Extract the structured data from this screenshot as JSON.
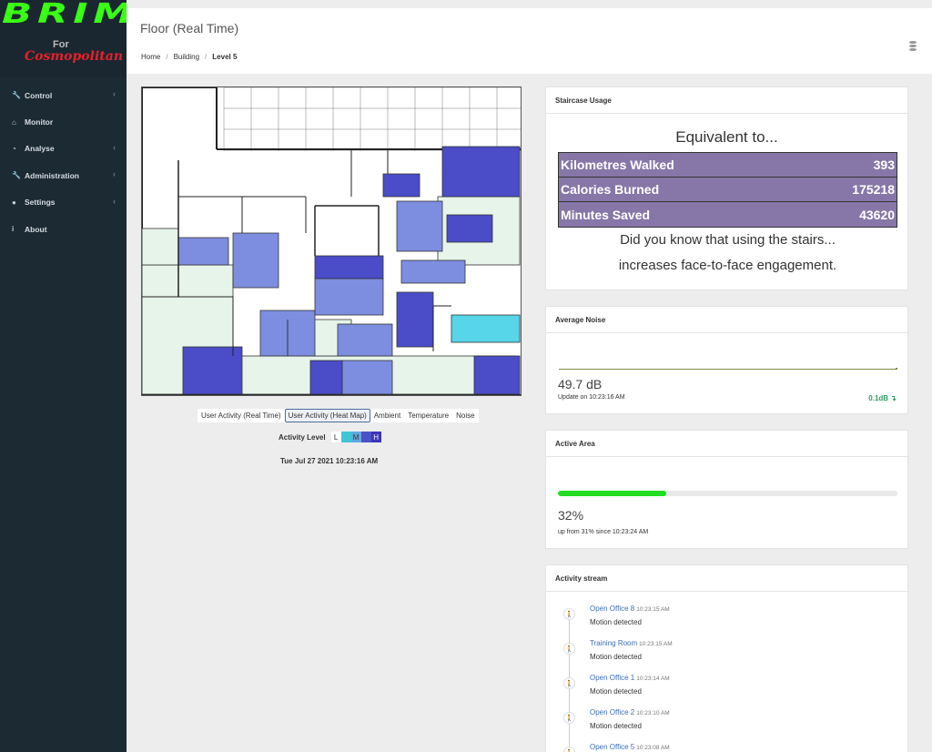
{
  "sidebar": {
    "brand": "BRIM",
    "for_label": "For",
    "client": "Cosmopolitan",
    "items": [
      {
        "label": "Control",
        "icon": "wrench-icon",
        "glyph": "🔧",
        "chevron": true
      },
      {
        "label": "Monitor",
        "icon": "home-icon",
        "glyph": "⌂",
        "chevron": false
      },
      {
        "label": "Analyse",
        "icon": "dashboard-icon",
        "glyph": "◔",
        "chevron": true
      },
      {
        "label": "Administration",
        "icon": "wrench-icon",
        "glyph": "🔧",
        "chevron": true
      },
      {
        "label": "Settings",
        "icon": "user-icon",
        "glyph": "●",
        "chevron": true
      },
      {
        "label": "About",
        "icon": "info-icon",
        "glyph": "i",
        "chevron": false
      }
    ]
  },
  "header": {
    "title": "Floor (Real Time)",
    "breadcrumb": [
      "Home",
      "Building",
      "Level 5"
    ]
  },
  "map": {
    "tabs": [
      "User Activity (Real Time)",
      "User Activity (Heat Map)",
      "Ambient",
      "Temperature",
      "Noise"
    ],
    "active_tab": 1,
    "activity_label": "Activity Level",
    "levels": [
      {
        "label": "L",
        "color": "#ffffff"
      },
      {
        "label": "",
        "color": "#3ec6d8"
      },
      {
        "label": "M",
        "color": "#62a8e0"
      },
      {
        "label": "",
        "color": "#4b52c6"
      },
      {
        "label": "H",
        "color": "#3b35b8"
      }
    ],
    "timestamp": "Tue Jul 27 2021 10:23:16 AM",
    "colors": {
      "low": "#e6f4ea",
      "mid": "#7d8ee0",
      "high": "#4a4cc8",
      "cyan": "#56d6e8"
    }
  },
  "stairs": {
    "title": "Staircase Usage",
    "heading": "Equivalent to...",
    "rows": [
      {
        "label": "Kilometres Walked",
        "value": "393"
      },
      {
        "label": "Calories Burned",
        "value": "175218"
      },
      {
        "label": "Minutes Saved",
        "value": "43620"
      }
    ],
    "note_line1": "Did you know that using the stairs...",
    "note_line2": "increases face-to-face engagement."
  },
  "noise": {
    "title": "Average Noise",
    "value": "49.7 dB",
    "update": "Update on 10:23:16 AM",
    "delta": "0.1dB ↴"
  },
  "active": {
    "title": "Active Area",
    "percent": 32,
    "value": "32%",
    "note": "up from 31% since 10:23:24 AM"
  },
  "stream": {
    "title": "Activity stream",
    "events": [
      {
        "room": "Open Office 8",
        "time": "10:23:15 AM",
        "msg": "Motion detected"
      },
      {
        "room": "Training Room",
        "time": "10:23:15 AM",
        "msg": "Motion detected"
      },
      {
        "room": "Open Office 1",
        "time": "10:23:14 AM",
        "msg": "Motion detected"
      },
      {
        "room": "Open Office 2",
        "time": "10:23:10 AM",
        "msg": "Motion detected"
      },
      {
        "room": "Open Office 5",
        "time": "10:23:08 AM",
        "msg": ""
      }
    ]
  }
}
